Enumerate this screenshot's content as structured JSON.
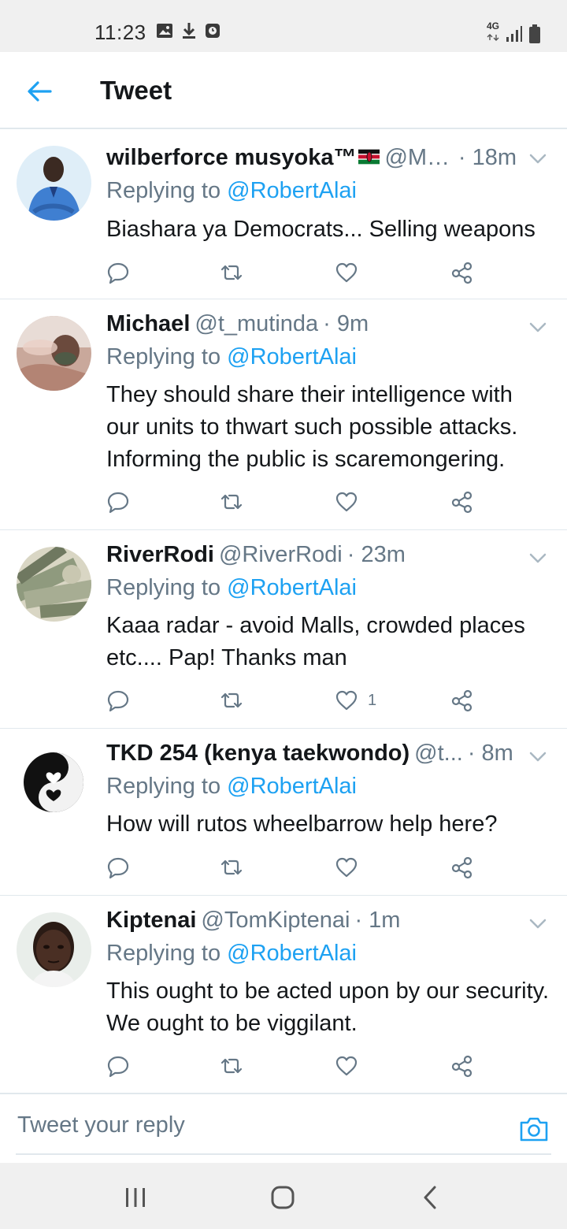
{
  "status_bar": {
    "time": "11:23",
    "network": "4G"
  },
  "header": {
    "title": "Tweet"
  },
  "colors": {
    "accent": "#1da1f2",
    "secondary_text": "#657786",
    "divider": "#e1e8ed"
  },
  "tweets": [
    {
      "name": "wilberforce musyoka™",
      "handle": "@Mu...",
      "time": "· 18m",
      "replying_label": "Replying to",
      "mention": "@RobertAlai",
      "text": "Biashara ya Democrats... Selling weapons",
      "likes": ""
    },
    {
      "name": "Michael",
      "handle": "@t_mutinda",
      "time": "· 9m",
      "replying_label": "Replying to",
      "mention": "@RobertAlai",
      "text": "They should share their intelligence with our units to thwart such possible attacks. Informing the public is scaremongering.",
      "likes": ""
    },
    {
      "name": "RiverRodi",
      "handle": "@RiverRodi",
      "time": "· 23m",
      "replying_label": "Replying to",
      "mention": "@RobertAlai",
      "text": "Kaaa radar - avoid Malls, crowded places etc.... Pap! Thanks man",
      "likes": "1"
    },
    {
      "name": "TKD 254 (kenya taekwondo)",
      "handle": "@t...",
      "time": "· 8m",
      "replying_label": "Replying to",
      "mention": "@RobertAlai",
      "text": "How will rutos wheelbarrow help here?",
      "likes": ""
    },
    {
      "name": "Kiptenai",
      "handle": "@TomKiptenai",
      "time": "· 1m",
      "replying_label": "Replying to",
      "mention": "@RobertAlai",
      "text": "This ought to be acted upon by our security. We ought to be viggilant.",
      "likes": ""
    }
  ],
  "reply": {
    "placeholder": "Tweet your reply"
  },
  "icons": [
    "back-arrow-icon",
    "reply-icon",
    "retweet-icon",
    "like-icon",
    "share-icon",
    "chevron-down-icon",
    "camera-icon",
    "gallery-icon",
    "download-icon",
    "clock-icon",
    "signal-icon",
    "battery-icon",
    "recents-icon",
    "home-icon",
    "nav-back-icon"
  ]
}
